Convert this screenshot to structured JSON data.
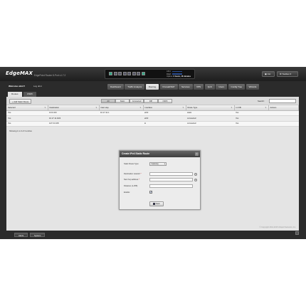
{
  "app": {
    "logo": "EdgeMAX",
    "subtitle": "EdgePoint Router 8-Port v1.7.2"
  },
  "device": {
    "cpu_label": "CPU:",
    "ram_label": "RAM:",
    "uptime_label": "Uptime:",
    "uptime_value": "2 hours, 16 minutes"
  },
  "header_buttons": {
    "cli": "CLI",
    "toolbox": "Toolbox"
  },
  "user": {
    "welcome": "Welcome ubnt",
    "logout": "Log ubnt"
  },
  "nav_tabs": [
    "Dashboard",
    "Traffic Analysis",
    "Routing",
    "Firewall/NAT",
    "Services",
    "VPN",
    "QoS",
    "Users",
    "Config Tree",
    "Wizards"
  ],
  "nav_active": "Routing",
  "sub_tabs": [
    "Routes",
    "OSPF"
  ],
  "toolbar": {
    "add_button": "Add Static Route",
    "filters": [
      "All",
      "Static",
      "Connected",
      "RIP",
      "OSPF"
    ],
    "search_label": "Search:",
    "search_value": ""
  },
  "table": {
    "columns": [
      "Selected",
      "Destination",
      "Next Hop",
      "Interface",
      "Route Type",
      "In FIB",
      "Actions"
    ],
    "rows": [
      [
        "Yes",
        "0.0.0.0/0",
        "10.17.11.1",
        "eth0",
        "static",
        "Yes",
        ""
      ],
      [
        "Yes",
        "10.17.11.0/24",
        "",
        "eth0",
        "connected",
        "Yes",
        ""
      ],
      [
        "Yes",
        "127.0.0.0/8",
        "",
        "lo",
        "connected",
        "Yes",
        ""
      ]
    ],
    "showing": "Showing 1 to 3 of 3 entries"
  },
  "modal": {
    "title": "Create IPv4 Static Route",
    "route_type_label": "Static Route Type:",
    "route_type_value": "Gateway",
    "destination_label": "Destination network",
    "next_hop_label": "Next hop address",
    "distance_label": "Distance (1-255):",
    "enable_label": "Enable:",
    "save_label": "Save"
  },
  "footer": {
    "copyright": "© Copyright 2012-2015 Ubiquiti Networks, Inc.",
    "tabs": [
      "Alerts",
      "System"
    ]
  },
  "colors": {
    "dark_bg": "#2b2b2b",
    "panel_bg": "#e4e4e4",
    "accent": "#2a4c8f"
  }
}
